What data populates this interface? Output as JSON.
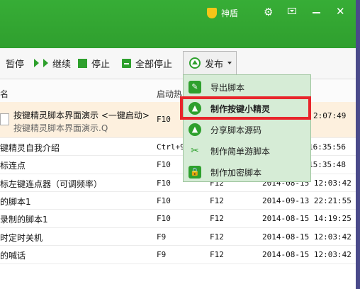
{
  "titlebar": {
    "shield_label": "神盾",
    "shield_icon": "shield-icon",
    "settings_icon": "gear-icon",
    "menu_icon": "dropdown-menu-icon",
    "minimize_icon": "minimize-icon",
    "close_icon": "close-icon"
  },
  "toolbar": {
    "pause_label": "暂停",
    "resume_label": "继续",
    "stop_label": "停止",
    "stop_all_label": "全部停止",
    "publish_label": "发布"
  },
  "table": {
    "headers": {
      "name_partial": "名",
      "startkey_partial": "启动热"
    },
    "rows": [
      {
        "name": "按键精灵脚本界面演示 <一键启动>",
        "sub": "按键精灵脚本界面演示.Q",
        "key1": "F10",
        "key2": "",
        "time": "2:07:49"
      },
      {
        "name": "键精灵自我介绍",
        "key1": "Ctrl+9",
        "key2": "",
        "time": "16:35:56"
      },
      {
        "name": "标连点",
        "key1": "F10",
        "key2": "",
        "time": "15:35:48"
      },
      {
        "name": "标左键连点器（可调频率）",
        "key1": "F10",
        "key2": "F12",
        "time": "2014-08-15 12:03:42"
      },
      {
        "name": "的脚本1",
        "key1": "F10",
        "key2": "F12",
        "time": "2014-09-13 22:21:55"
      },
      {
        "name": "录制的脚本1",
        "key1": "F10",
        "key2": "F12",
        "time": "2014-08-15 14:19:25"
      },
      {
        "name": "时定时关机",
        "key1": "F9",
        "key2": "F12",
        "time": "2014-08-15 12:03:42"
      },
      {
        "name": "的喊话",
        "key1": "F9",
        "key2": "F12",
        "time": "2014-08-15 12:03:42"
      }
    ]
  },
  "publish_menu": {
    "items": [
      {
        "label": "导出脚本",
        "icon": "export-icon"
      },
      {
        "label": "制作按键小精灵",
        "icon": "make-wizard-icon"
      },
      {
        "label": "分享脚本源码",
        "icon": "share-icon"
      },
      {
        "label": "制作简单游脚本",
        "icon": "game-script-icon"
      },
      {
        "label": "制作加密脚本",
        "icon": "encrypt-icon"
      }
    ]
  },
  "colors": {
    "brand_green": "#2ea02d",
    "menu_bg": "#d6ecd6",
    "highlight_red": "#e8252b",
    "selected_row": "#fdf0de"
  }
}
